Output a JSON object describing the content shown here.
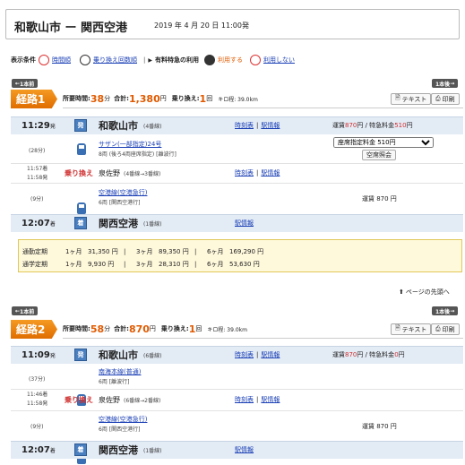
{
  "header": {
    "title": "和歌山市 ー 関西空港",
    "datetime": "2019 年 4 月 20 日 11:00発"
  },
  "options": {
    "label": "表示条件",
    "sort_time": "時間順",
    "transfers": "乗り換え回数順",
    "express_label": "有料特急の利用",
    "express_use": "利用する",
    "express_nouse": "利用しない"
  },
  "nav": {
    "prev": "1本前",
    "next": "1本後"
  },
  "route1": {
    "label": "経路1",
    "time_label": "所要時間:",
    "time_val": "38",
    "time_unit": "分",
    "total_label": "合計:",
    "total_val": "1,380",
    "yen": "円",
    "trans_label": "乗り換え:",
    "trans_val": "1",
    "trans_unit": "回",
    "dist": "キロ程: 39.0km",
    "text_btn": "テキスト",
    "print_btn": "印刷",
    "dep_time": "11:29",
    "dep_suffix": "発",
    "dep_badge": "発",
    "dep_station": "和歌山市",
    "dep_platform": "(4番線)",
    "timetable": "時刻表",
    "station_info": "駅情報",
    "fare_line_pre": "運賃",
    "fare_line_val1": "870",
    "fare_line_mid": "円 / 特急料金",
    "fare_line_val2": "510",
    "fare_line_suf": "円",
    "seg1_min": "(28分)",
    "seg1_train": "サザン(一部指定)24号",
    "seg1_cars": "8両 (後ろ4両座席指定) [離波行]",
    "seat_select": "座席指定料金 510円",
    "seat_btn": "空席照会",
    "transfer_arr": "11:57着",
    "transfer_dep": "11:58発",
    "transfer_label": "乗り換え",
    "transfer_station": "泉佐野",
    "transfer_platform": "(4番線→3番線)",
    "seg2_min": "(9分)",
    "seg2_train": "空港線(空港急行)",
    "seg2_cars": "6両 [関西空港行]",
    "seg2_fare": "運賃 870 円",
    "arr_time": "12:07",
    "arr_suffix": "着",
    "arr_badge": "着",
    "arr_station": "関西空港",
    "arr_platform": "(1番線)"
  },
  "commute": {
    "row1_label": "通勤定期",
    "row2_label": "通学定期",
    "m1": "1ヶ月",
    "m3": "3ヶ月",
    "m6": "6ヶ月",
    "row1": [
      "31,350 円",
      "89,350 円",
      "169,290 円"
    ],
    "row2": [
      "9,930 円",
      "28,310 円",
      "53,630 円"
    ]
  },
  "page_top": "ページの先頭へ",
  "route2": {
    "label": "経路2",
    "time_label": "所要時間:",
    "time_val": "58",
    "time_unit": "分",
    "total_label": "合計:",
    "total_val": "870",
    "yen": "円",
    "trans_label": "乗り換え:",
    "trans_val": "1",
    "trans_unit": "回",
    "dist": "キロ程: 39.0km",
    "text_btn": "テキスト",
    "print_btn": "印刷",
    "dep_time": "11:09",
    "dep_suffix": "発",
    "dep_badge": "発",
    "dep_station": "和歌山市",
    "dep_platform": "(6番線)",
    "timetable": "時刻表",
    "station_info": "駅情報",
    "fare_line_pre": "運賃",
    "fare_line_val1": "870",
    "fare_line_mid": "円 / 特急料金",
    "fare_line_val2": "0",
    "fare_line_suf": "円",
    "seg1_min": "(37分)",
    "seg1_train": "南海本線(普通)",
    "seg1_cars": "6両 [離波行]",
    "transfer_arr": "11:46着",
    "transfer_dep": "11:58発",
    "transfer_label": "乗り換え",
    "transfer_station": "泉佐野",
    "transfer_platform": "(6番線→2番線)",
    "seg2_min": "(9分)",
    "seg2_train": "空港線(空港急行)",
    "seg2_cars": "6両 [関西空港行]",
    "seg2_fare": "運賃 870 円",
    "arr_time": "12:07",
    "arr_suffix": "着",
    "arr_badge": "着",
    "arr_station": "関西空港",
    "arr_platform": "(1番線)"
  }
}
